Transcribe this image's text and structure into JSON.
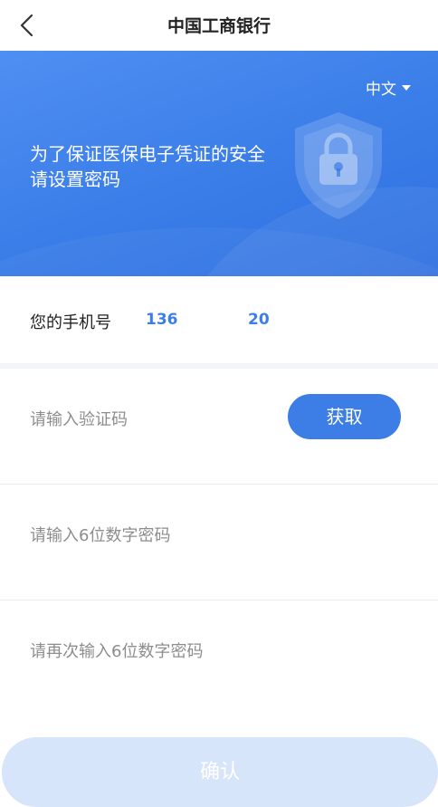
{
  "header": {
    "title": "中国工商银行",
    "back_icon": "chevron-left-icon"
  },
  "banner": {
    "language": "中文",
    "message_line1": "为了保证医保电子凭证的安全",
    "message_line2": "请设置密码",
    "icon": "shield-lock-icon",
    "colors": {
      "start": "#4f8ff2",
      "end": "#2f6fe0"
    }
  },
  "phone": {
    "label": "您的手机号",
    "prefix": "136",
    "suffix": "20"
  },
  "form": {
    "code_placeholder": "请输入验证码",
    "get_code_label": "获取",
    "password_placeholder": "请输入6位数字密码",
    "password_confirm_placeholder": "请再次输入6位数字密码"
  },
  "confirm_label": "确认",
  "colors": {
    "accent": "#3c7ee6",
    "confirm_disabled": "#d7e5fb"
  }
}
